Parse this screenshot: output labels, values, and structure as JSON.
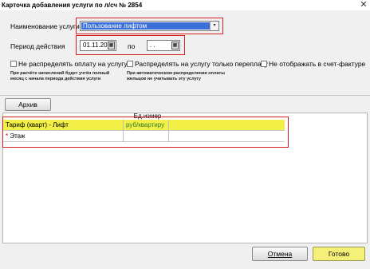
{
  "window": {
    "title": "Карточка добавления услуги по л/сч № 2854",
    "close_glyph": "✕"
  },
  "form": {
    "service_label": "Наименование услуги",
    "service_value": "Пользование лифтом",
    "period_label": "Период действия",
    "date_from": "01.11.20",
    "to_label": "по",
    "date_to": ". ."
  },
  "options": [
    {
      "label": "Не распределять оплату на услугу",
      "checked": false
    },
    {
      "label": "Распределять на  услугу только переплату",
      "checked": false
    },
    {
      "label": "Не отображать в счет-фактуре",
      "checked": false
    }
  ],
  "notes": {
    "note1_line1": "При расчёте начислений будет учтён  полный",
    "note1_line2": "месяц с начала периода действия услуги",
    "note2_line1": "При автоматическом распределении оплаты",
    "note2_line2": "жильцов не учитывать эту услугу"
  },
  "toolbar": {
    "archive_label": "Архив"
  },
  "grid": {
    "header_unit": "Ед.измер",
    "rows": [
      {
        "name": "Тариф (кварт) - Лифт",
        "unit": "руб/квартиру",
        "value": "",
        "highlight": true,
        "marker": ""
      },
      {
        "name": "Этаж",
        "unit": "",
        "value": "",
        "highlight": false,
        "marker": "*"
      }
    ]
  },
  "buttons": {
    "cancel_label": "Отмена",
    "ok_label": "Готово"
  },
  "colors": {
    "highlight_row": "#f2f046",
    "selection": "#3a6fd8",
    "annotation_red": "#d42020",
    "ok_button": "#f4f07a",
    "unit_text": "#2e7d32"
  }
}
